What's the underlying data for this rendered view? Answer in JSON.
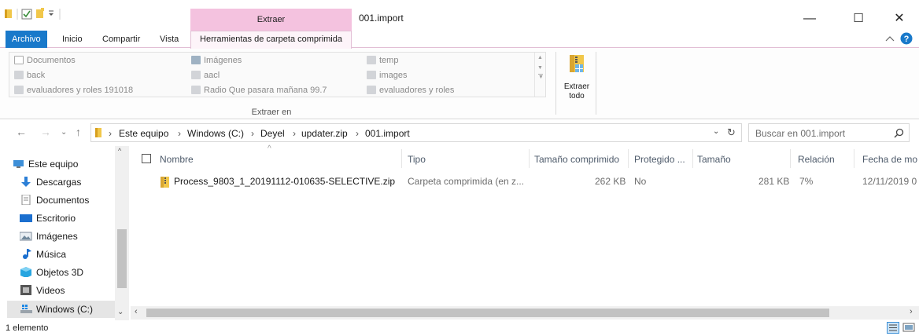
{
  "window": {
    "title": "001.import",
    "context_header": "Extraer",
    "minimize": "—",
    "maximize": "☐",
    "close": "✕"
  },
  "ribbon_tabs": {
    "file": "Archivo",
    "home": "Inicio",
    "share": "Compartir",
    "view": "Vista",
    "context": "Herramientas de carpeta comprimida"
  },
  "ribbon": {
    "gallery": [
      {
        "label": "Documentos",
        "icon": "documents-icon"
      },
      {
        "label": "back",
        "icon": "folder-icon"
      },
      {
        "label": "evaluadores y roles 191018",
        "icon": "folder-icon"
      },
      {
        "label": "Imágenes",
        "icon": "pictures-icon"
      },
      {
        "label": "aacl",
        "icon": "folder-icon"
      },
      {
        "label": "Radio Que pasara mañana 99.7",
        "icon": "folder-icon"
      },
      {
        "label": "temp",
        "icon": "folder-icon"
      },
      {
        "label": "images",
        "icon": "folder-icon"
      },
      {
        "label": "evaluadores y roles",
        "icon": "folder-icon"
      }
    ],
    "group_label": "Extraer en",
    "extract_all": "Extraer todo"
  },
  "address": {
    "crumbs": [
      "Este equipo",
      "Windows (C:)",
      "Deyel",
      "updater.zip",
      "001.import"
    ],
    "search_placeholder": "Buscar en 001.import"
  },
  "nav": {
    "items": [
      {
        "label": "Este equipo",
        "icon": "this-pc-icon"
      },
      {
        "label": "Descargas",
        "icon": "downloads-icon"
      },
      {
        "label": "Documentos",
        "icon": "documents-icon"
      },
      {
        "label": "Escritorio",
        "icon": "desktop-icon"
      },
      {
        "label": "Imágenes",
        "icon": "pictures-icon"
      },
      {
        "label": "Música",
        "icon": "music-icon"
      },
      {
        "label": "Objetos 3D",
        "icon": "3d-objects-icon"
      },
      {
        "label": "Videos",
        "icon": "videos-icon"
      },
      {
        "label": "Windows (C:)",
        "icon": "drive-icon"
      }
    ]
  },
  "columns": {
    "name": "Nombre",
    "type": "Tipo",
    "compressed_size": "Tamaño comprimido",
    "protected": "Protegido ...",
    "size": "Tamaño",
    "ratio": "Relación",
    "date": "Fecha de mo"
  },
  "files": [
    {
      "name": "Process_9803_1_20191112-010635-SELECTIVE.zip",
      "type": "Carpeta comprimida (en z...",
      "compressed_size": "262 KB",
      "protected": "No",
      "size": "281 KB",
      "ratio": "7%",
      "date": "12/11/2019 0"
    }
  ],
  "status": {
    "count": "1 elemento"
  },
  "colors": {
    "accent": "#1979ca",
    "context_tab": "#f4c2df",
    "folder": "#f1c74a"
  }
}
